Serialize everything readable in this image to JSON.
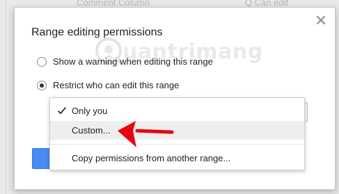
{
  "background": {
    "fragments": [
      "Comment",
      "Column",
      "Q  Can edit"
    ]
  },
  "dialog": {
    "title": "Range editing permissions",
    "close_icon": "close-icon"
  },
  "watermark": {
    "text": "uantrimang",
    "icon": "watermark-logo-icon"
  },
  "options": [
    {
      "label": "Show a warning when editing this range",
      "checked": false
    },
    {
      "label": "Restrict who can edit this range",
      "checked": true
    }
  ],
  "dropdown": {
    "items": [
      {
        "label": "Only you",
        "checked": true
      },
      {
        "label": "Custom...",
        "checked": false,
        "highlighted": true
      },
      {
        "label": "Copy permissions from another range...",
        "checked": false
      }
    ]
  },
  "colors": {
    "accent_blue": "#4a8af4",
    "arrow_red": "#e8000f",
    "hover_gray": "#eeeeee"
  }
}
